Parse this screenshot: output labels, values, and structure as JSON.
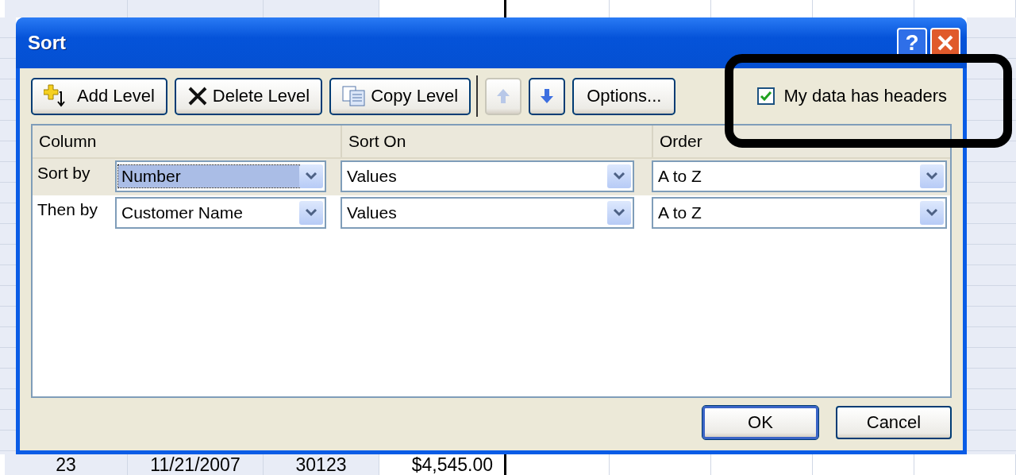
{
  "spreadsheet": {
    "bottom_row": [
      "23",
      "11/21/2007",
      "30123",
      "$4,545.00"
    ]
  },
  "dialog": {
    "title": "Sort",
    "help_button": "?",
    "toolbar": [
      {
        "kind": "add",
        "label": "Add Level"
      },
      {
        "kind": "delete",
        "label": "Delete Level"
      },
      {
        "kind": "copy",
        "label": "Copy Level"
      },
      {
        "kind": "up",
        "disabled": true
      },
      {
        "kind": "down",
        "disabled": false
      },
      {
        "kind": "text",
        "label": "Options..."
      }
    ],
    "headers_checkbox": {
      "label": "My data has headers",
      "checked": true
    },
    "columns": [
      "Column",
      "Sort On",
      "Order"
    ],
    "levels": [
      {
        "label": "Sort by",
        "column": "Number",
        "sort_on": "Values",
        "order": "A to Z",
        "selected": true
      },
      {
        "label": "Then by",
        "column": "Customer Name",
        "sort_on": "Values",
        "order": "A to Z",
        "selected": false
      }
    ],
    "buttons": [
      {
        "label": "OK",
        "default": true
      },
      {
        "label": "Cancel",
        "default": false
      }
    ]
  }
}
